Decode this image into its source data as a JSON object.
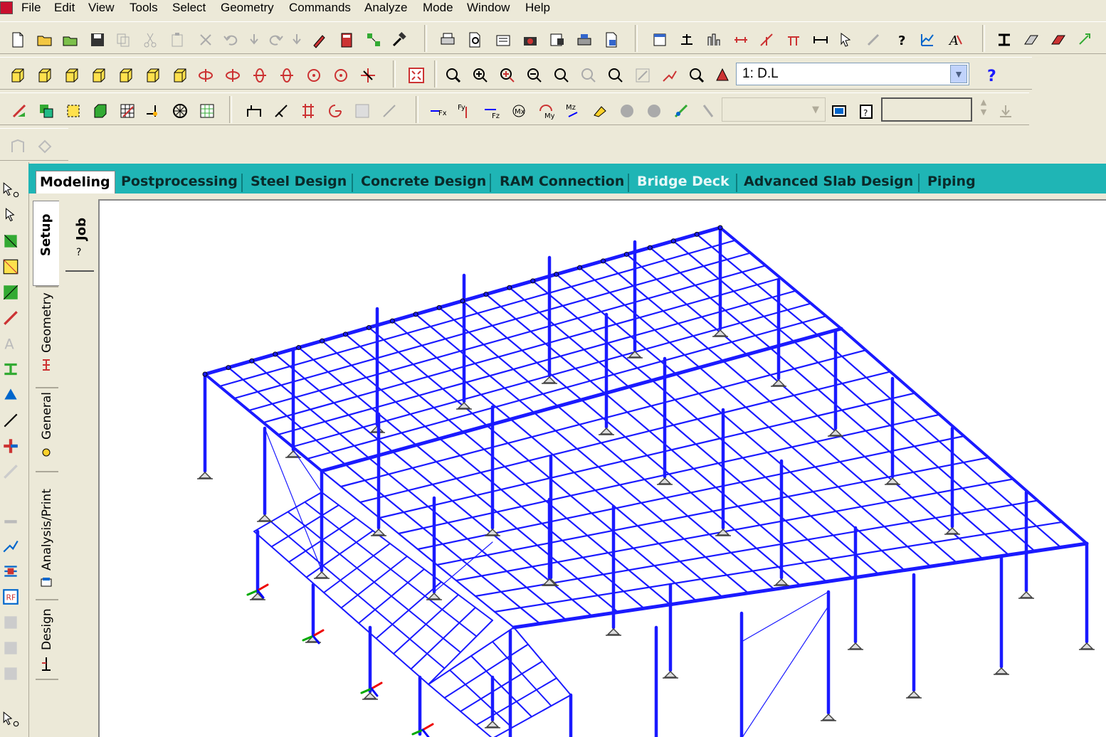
{
  "menubar": {
    "items": [
      "File",
      "Edit",
      "View",
      "Tools",
      "Select",
      "Geometry",
      "Commands",
      "Analyze",
      "Mode",
      "Window",
      "Help"
    ]
  },
  "toolbar": {
    "load_case": "1: D.L",
    "help_icon": "help-icon"
  },
  "tabs": [
    {
      "label": "Modeling",
      "state": "active"
    },
    {
      "label": "Postprocessing",
      "state": "normal"
    },
    {
      "label": "Steel Design",
      "state": "normal"
    },
    {
      "label": "Concrete Design",
      "state": "normal"
    },
    {
      "label": "RAM Connection",
      "state": "normal"
    },
    {
      "label": "Bridge Deck",
      "state": "disabled"
    },
    {
      "label": "Advanced Slab Design",
      "state": "normal"
    },
    {
      "label": "Piping",
      "state": "normal"
    }
  ],
  "side_tabs": {
    "setup": "Setup",
    "geometry": "Geometry",
    "general": "General",
    "analysis": "Analysis/Print",
    "design": "Design",
    "job": "Job"
  },
  "colors": {
    "member": "#1a1aff",
    "tab_bar": "#1fb5b5",
    "support": "#444444"
  }
}
